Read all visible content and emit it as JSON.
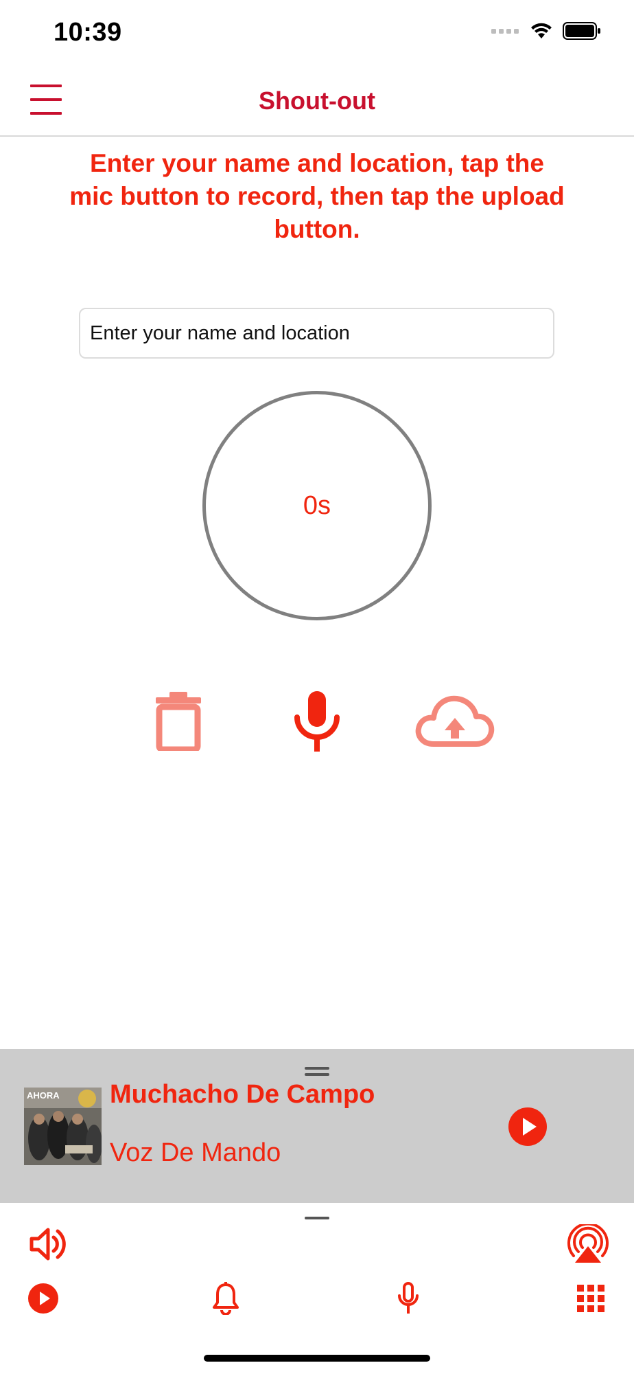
{
  "status_bar": {
    "time": "10:39"
  },
  "nav": {
    "title": "Shout-out"
  },
  "instructions": "Enter your name and location, tap the mic button to record, then tap the upload button.",
  "name_field": {
    "placeholder": "Enter your name and location",
    "value": ""
  },
  "timer": {
    "display": "0s"
  },
  "now_playing": {
    "title": "Muchacho De Campo",
    "artist": "Voz De Mando"
  },
  "toolbar": {
    "top_icons": [
      "volume-icon",
      "airplay-icon"
    ],
    "bottom_icons": [
      "play-icon",
      "bell-icon",
      "mic-icon",
      "grid-icon"
    ]
  },
  "colors": {
    "accent": "#f0250f",
    "title": "#c8102e",
    "player_bg": "#cccccc",
    "menu": "#c8102e"
  }
}
